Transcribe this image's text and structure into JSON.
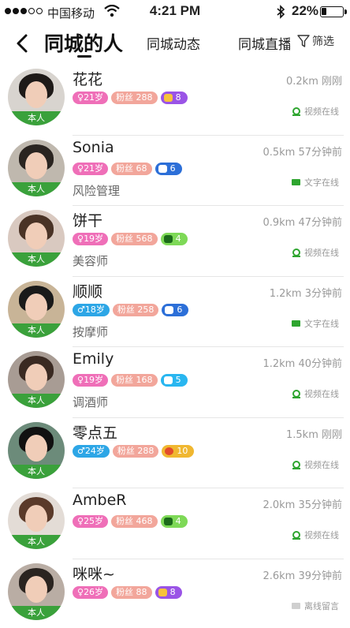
{
  "status_bar": {
    "carrier": "中国移动",
    "time": "4:21 PM",
    "battery": "22%",
    "battery_level": 0.22
  },
  "nav": {
    "tabs": [
      "同城的人",
      "同城动态",
      "同城直播"
    ],
    "filter_label": "筛选"
  },
  "self_label": "本人",
  "users": [
    {
      "name": "花花",
      "age": "21岁",
      "gender": "female",
      "fans": "粉丝 288",
      "level": "8",
      "level_color": "purple",
      "job": "",
      "meta": "0.2km 刚刚",
      "status": "视频在线",
      "status_type": "video"
    },
    {
      "name": "Sonia",
      "age": "21岁",
      "gender": "female",
      "fans": "粉丝 68",
      "level": "6",
      "level_color": "blue",
      "job": "风险管理",
      "meta": "0.5km 57分钟前",
      "status": "文字在线",
      "status_type": "text"
    },
    {
      "name": "饼干",
      "age": "19岁",
      "gender": "female",
      "fans": "粉丝 568",
      "level": "4",
      "level_color": "green",
      "job": "美容师",
      "meta": "0.9km 47分钟前",
      "status": "视频在线",
      "status_type": "video"
    },
    {
      "name": "顺顺",
      "age": "18岁",
      "gender": "male",
      "fans": "粉丝 258",
      "level": "6",
      "level_color": "blue",
      "job": "按摩师",
      "meta": "1.2km 3分钟前",
      "status": "文字在线",
      "status_type": "text"
    },
    {
      "name": "Emily",
      "age": "19岁",
      "gender": "female",
      "fans": "粉丝 168",
      "level": "5",
      "level_color": "cyan",
      "job": "调酒师",
      "meta": "1.2km 40分钟前",
      "status": "视频在线",
      "status_type": "video"
    },
    {
      "name": "零点五",
      "age": "24岁",
      "gender": "male",
      "fans": "粉丝 288",
      "level": "10",
      "level_color": "yellow",
      "job": "",
      "meta": "1.5km 刚刚",
      "status": "视频在线",
      "status_type": "video"
    },
    {
      "name": "AmbeR",
      "age": "25岁",
      "gender": "female",
      "fans": "粉丝 468",
      "level": "4",
      "level_color": "green",
      "job": "",
      "meta": "2.0km 35分钟前",
      "status": "视频在线",
      "status_type": "video"
    },
    {
      "name": "咪咪~",
      "age": "26岁",
      "gender": "female",
      "fans": "粉丝 88",
      "level": "8",
      "level_color": "purple",
      "job": "",
      "meta": "2.6km 39分钟前",
      "status": "离线留言",
      "status_type": "offline"
    }
  ]
}
